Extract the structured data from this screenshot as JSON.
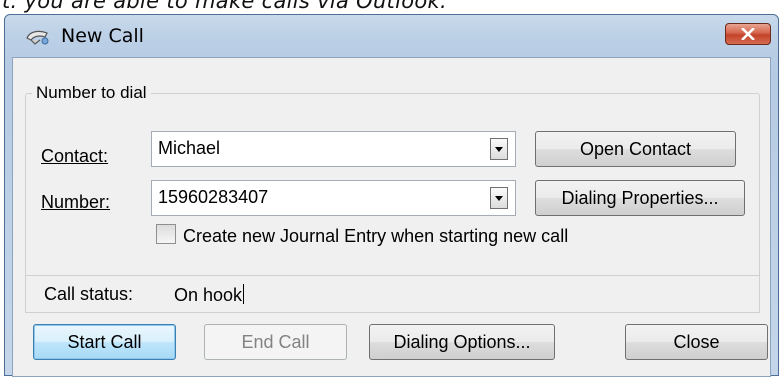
{
  "page_caption": "t. you are able to make calls via Outlook.",
  "window": {
    "title": "New Call",
    "icon": "phone-icon",
    "close_icon": "close-icon",
    "accent_close": "#c8452c"
  },
  "number_group": {
    "legend": "Number to dial",
    "contact_label": "Contact:",
    "contact_value": "Michael",
    "number_label": "Number:",
    "number_value": "15960283407",
    "open_contact_button": "Open Contact",
    "dialing_properties_button": "Dialing Properties...",
    "journal_checkbox_label": "Create new Journal Entry when starting new call",
    "journal_checked": false
  },
  "status": {
    "label": "Call status:",
    "value": "On hook"
  },
  "buttons": {
    "start_call": "Start Call",
    "end_call": "End Call",
    "dialing_options": "Dialing Options...",
    "close": "Close"
  }
}
